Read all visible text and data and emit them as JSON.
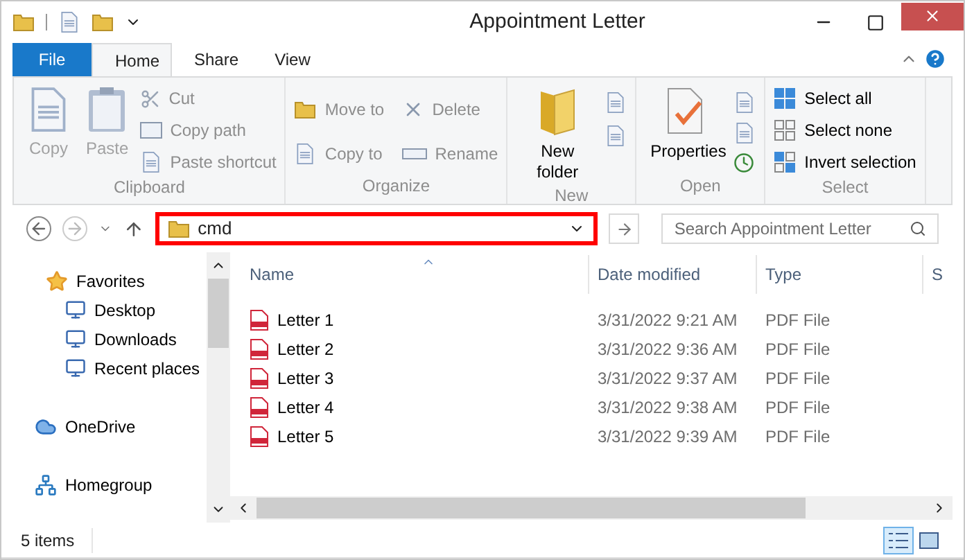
{
  "window": {
    "title": "Appointment Letter"
  },
  "ribbon": {
    "tabs": [
      {
        "label": "File",
        "kind": "file",
        "selected": false
      },
      {
        "label": "Home",
        "kind": "tab",
        "selected": true
      },
      {
        "label": "Share",
        "kind": "tab",
        "selected": false
      },
      {
        "label": "View",
        "kind": "tab",
        "selected": false
      }
    ],
    "groups": [
      {
        "label": "Clipboard",
        "items": [
          {
            "label": "Copy",
            "kind": "large",
            "disabled": true
          },
          {
            "label": "Paste",
            "kind": "large",
            "disabled": true
          },
          {
            "label": "Cut",
            "kind": "small",
            "disabled": true
          },
          {
            "label": "Copy path",
            "kind": "small",
            "disabled": true
          },
          {
            "label": "Paste shortcut",
            "kind": "small",
            "disabled": true
          }
        ]
      },
      {
        "label": "Organize",
        "items": [
          {
            "label": "Move to",
            "kind": "small",
            "disabled": true
          },
          {
            "label": "Copy to",
            "kind": "small",
            "disabled": true
          },
          {
            "label": "Delete",
            "kind": "small",
            "disabled": true
          },
          {
            "label": "Rename",
            "kind": "small",
            "disabled": true
          }
        ]
      },
      {
        "label": "New",
        "items": [
          {
            "label": "New folder",
            "kind": "large",
            "disabled": false
          }
        ]
      },
      {
        "label": "Open",
        "items": [
          {
            "label": "Properties",
            "kind": "large",
            "disabled": false
          }
        ]
      },
      {
        "label": "Select",
        "items": [
          {
            "label": "Select all",
            "kind": "small",
            "disabled": false
          },
          {
            "label": "Select none",
            "kind": "small",
            "disabled": false
          },
          {
            "label": "Invert selection",
            "kind": "small",
            "disabled": false
          }
        ]
      }
    ]
  },
  "address": {
    "path": "cmd",
    "highlighted": true
  },
  "search": {
    "placeholder": "Search Appointment Letter"
  },
  "navigation": [
    {
      "label": "Favorites",
      "children": [
        {
          "label": "Desktop"
        },
        {
          "label": "Downloads"
        },
        {
          "label": "Recent places"
        }
      ]
    },
    {
      "label": "OneDrive"
    },
    {
      "label": "Homegroup"
    }
  ],
  "files": {
    "columns": [
      {
        "label": "Name"
      },
      {
        "label": "Date modified"
      },
      {
        "label": "Type"
      },
      {
        "label": "S"
      }
    ],
    "rows": [
      {
        "name": "Letter 1",
        "date": "3/31/2022 9:21 AM",
        "type": "PDF File"
      },
      {
        "name": "Letter 2",
        "date": "3/31/2022 9:36 AM",
        "type": "PDF File"
      },
      {
        "name": "Letter 3",
        "date": "3/31/2022 9:37 AM",
        "type": "PDF File"
      },
      {
        "name": "Letter 4",
        "date": "3/31/2022 9:38 AM",
        "type": "PDF File"
      },
      {
        "name": "Letter 5",
        "date": "3/31/2022 9:39 AM",
        "type": "PDF File"
      }
    ]
  },
  "status_bar": {
    "count": "5 items",
    "views": [
      {
        "selected": true
      },
      {
        "selected": false
      }
    ]
  }
}
